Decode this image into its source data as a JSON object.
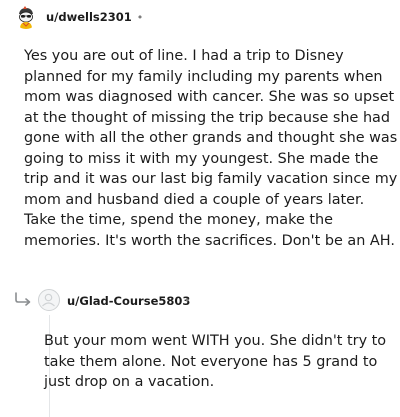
{
  "comment": {
    "username": "u/dwells2301",
    "separator": "•",
    "body_lines": [
      "Yes you are out of line. I had a trip to Disney",
      "planned for my family including my parents when",
      "mom was diagnosed with cancer. She was so upset",
      "at the thought of missing the trip because she had",
      "gone with all the other grands and thought she was",
      "going to miss it with my youngest. She made the",
      "trip and it was our last big family vacation since my",
      "mom and husband died a couple of years later.",
      "Take the time, spend the money, make the",
      "memories. It's worth the sacrifices. Don't be an AH."
    ]
  },
  "reply": {
    "username": "u/Glad-Course5803",
    "separator": "•",
    "body_lines": [
      "But your mom went WITH you. She didn't try to",
      "take them alone. Not everyone has 5 grand to",
      "just drop on a vacation."
    ]
  },
  "icons": {
    "comment_avatar": "snoo-avatar-icon",
    "reply_arrow": "reply-arrow-icon",
    "reply_avatar": "default-avatar-icon"
  },
  "colors": {
    "text": "#1c1c1c",
    "meta": "#7c7c7c",
    "thread_line": "#e4e6e8"
  }
}
